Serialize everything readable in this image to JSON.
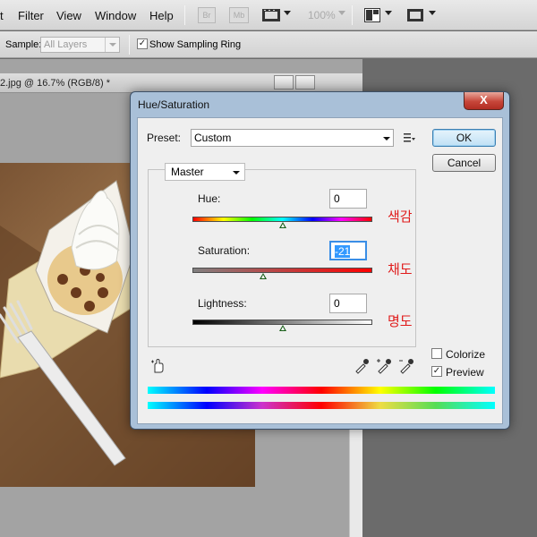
{
  "menubar": {
    "items": [
      "t",
      "Filter",
      "View",
      "Window",
      "Help"
    ],
    "bridge_label": "Br",
    "minibridge_label": "Mb",
    "zoom": "100%"
  },
  "options": {
    "sample_label": "Sample:",
    "sample_value": "All Layers",
    "show_sampling_ring": "Show Sampling Ring"
  },
  "document": {
    "title": "2.jpg @ 16.7% (RGB/8) *"
  },
  "dialog": {
    "title": "Hue/Saturation",
    "close_label": "X",
    "preset_label": "Preset:",
    "preset_value": "Custom",
    "ok_label": "OK",
    "cancel_label": "Cancel",
    "edit_range": "Master",
    "hue": {
      "label": "Hue:",
      "value": "0",
      "annotation": "색감",
      "slider": 0
    },
    "saturation": {
      "label": "Saturation:",
      "value": "-21",
      "annotation": "채도",
      "slider": -21
    },
    "lightness": {
      "label": "Lightness:",
      "value": "0",
      "annotation": "명도",
      "slider": 0
    },
    "colorize_label": "Colorize",
    "colorize_checked": false,
    "preview_label": "Preview",
    "preview_checked": true
  }
}
